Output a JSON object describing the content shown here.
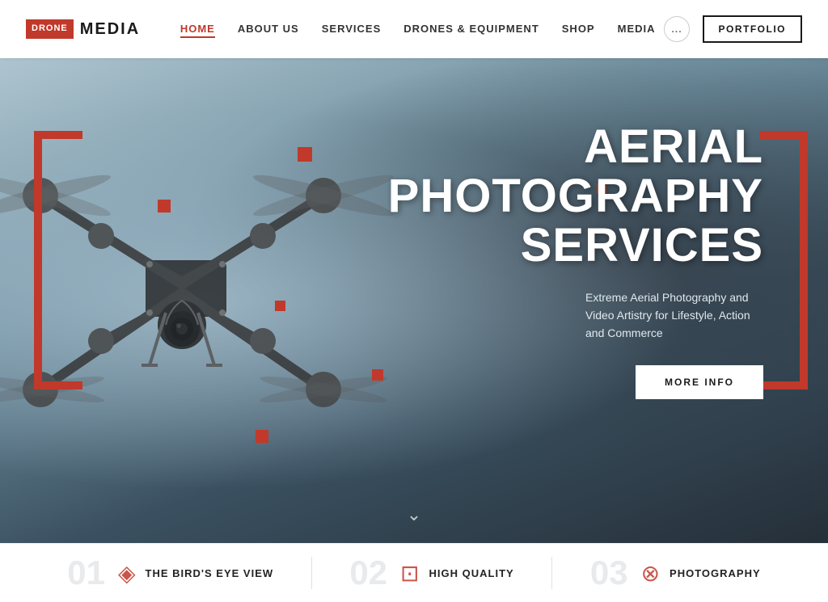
{
  "brand": {
    "logo_box": "DRONE",
    "logo_text": "MEDIA"
  },
  "nav": {
    "links": [
      {
        "label": "HOME",
        "active": true
      },
      {
        "label": "ABOUT US",
        "active": false
      },
      {
        "label": "SERVICES",
        "active": false
      },
      {
        "label": "DRONES & EQUIPMENT",
        "active": false
      },
      {
        "label": "SHOP",
        "active": false
      },
      {
        "label": "MEDIA",
        "active": false
      }
    ],
    "dots_label": "...",
    "portfolio_label": "PORTFOLIO"
  },
  "hero": {
    "title_line1": "AERIAL PHOTOGRAPHY",
    "title_line2": "SERVICES",
    "subtitle": "Extreme Aerial Photography and Video Artistry for Lifestyle, Action and Commerce",
    "cta_label": "MORE INFO",
    "scroll_icon": "⌄"
  },
  "bottom": {
    "items": [
      {
        "num": "01",
        "icon": "◈",
        "label": "THE BIRD'S EYE VIEW"
      },
      {
        "num": "02",
        "icon": "⊡",
        "label": "HIGH QUALITY"
      },
      {
        "num": "03",
        "icon": "⊗",
        "label": "PHOTOGRAPHY"
      }
    ]
  },
  "accent_color": "#c0392b"
}
